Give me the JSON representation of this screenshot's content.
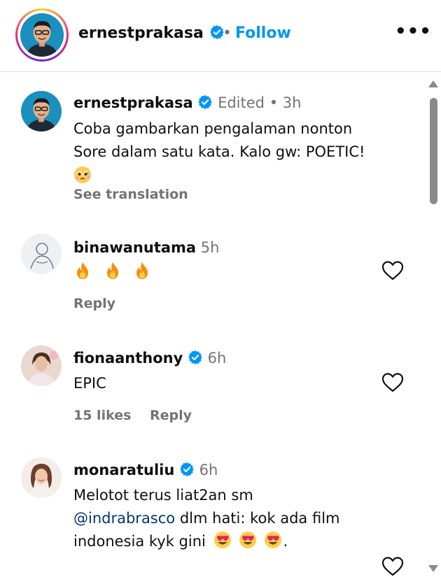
{
  "header": {
    "username": "ernestprakasa",
    "separator": "•",
    "follow_label": "Follow",
    "more_label": "•••"
  },
  "caption": {
    "username": "ernestprakasa",
    "edited": "Edited",
    "separator": "•",
    "time": "3h",
    "line1": "Coba gambarkan pengalaman nonton",
    "line2": "Sore dalam satu kata. Kalo gw: POETIC!",
    "see_translation": "See translation"
  },
  "comments": [
    {
      "username": "binawanutama",
      "time": "5h",
      "emoji": [
        "fire-emoji",
        "fire-emoji",
        "fire-emoji"
      ],
      "reply": "Reply"
    },
    {
      "username": "fionaanthony",
      "time": "6h",
      "text": "EPIC",
      "likes": "15 likes",
      "reply": "Reply"
    },
    {
      "username": "monaratuliu",
      "time": "6h",
      "line1": "Melotot terus liat2an sm",
      "mention": "@indrabrasco",
      "line2_rest": " dlm hati: kok ada film",
      "line3": "indonesia kyk gini",
      "line3_end": "."
    }
  ],
  "colors": {
    "link": "#0095f6",
    "muted": "#737373",
    "verified": "#0095f6",
    "mention": "#00376b"
  }
}
